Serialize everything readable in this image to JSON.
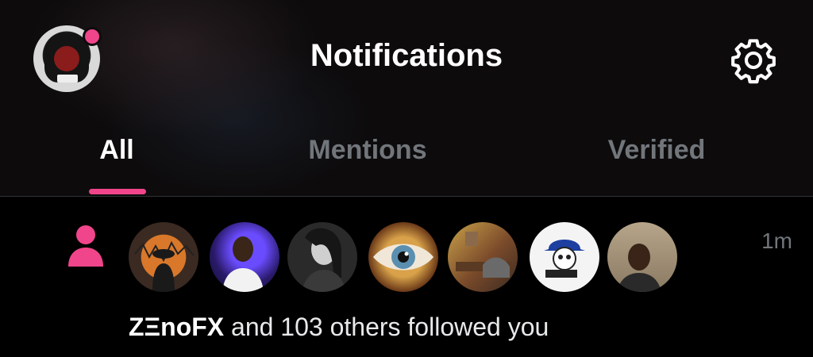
{
  "header": {
    "title": "Notifications",
    "has_unread_dot": true
  },
  "tabs": [
    {
      "label": "All",
      "active": true
    },
    {
      "label": "Mentions",
      "active": false
    },
    {
      "label": "Verified",
      "active": false
    }
  ],
  "notification": {
    "icon": "person-icon",
    "time": "1m",
    "actor_name": "ZΞnoFX",
    "message_rest": " and 103 others followed you",
    "avatar_count": 7
  },
  "colors": {
    "accent": "#f0458a",
    "background": "#000000",
    "muted_text": "#71767b"
  }
}
